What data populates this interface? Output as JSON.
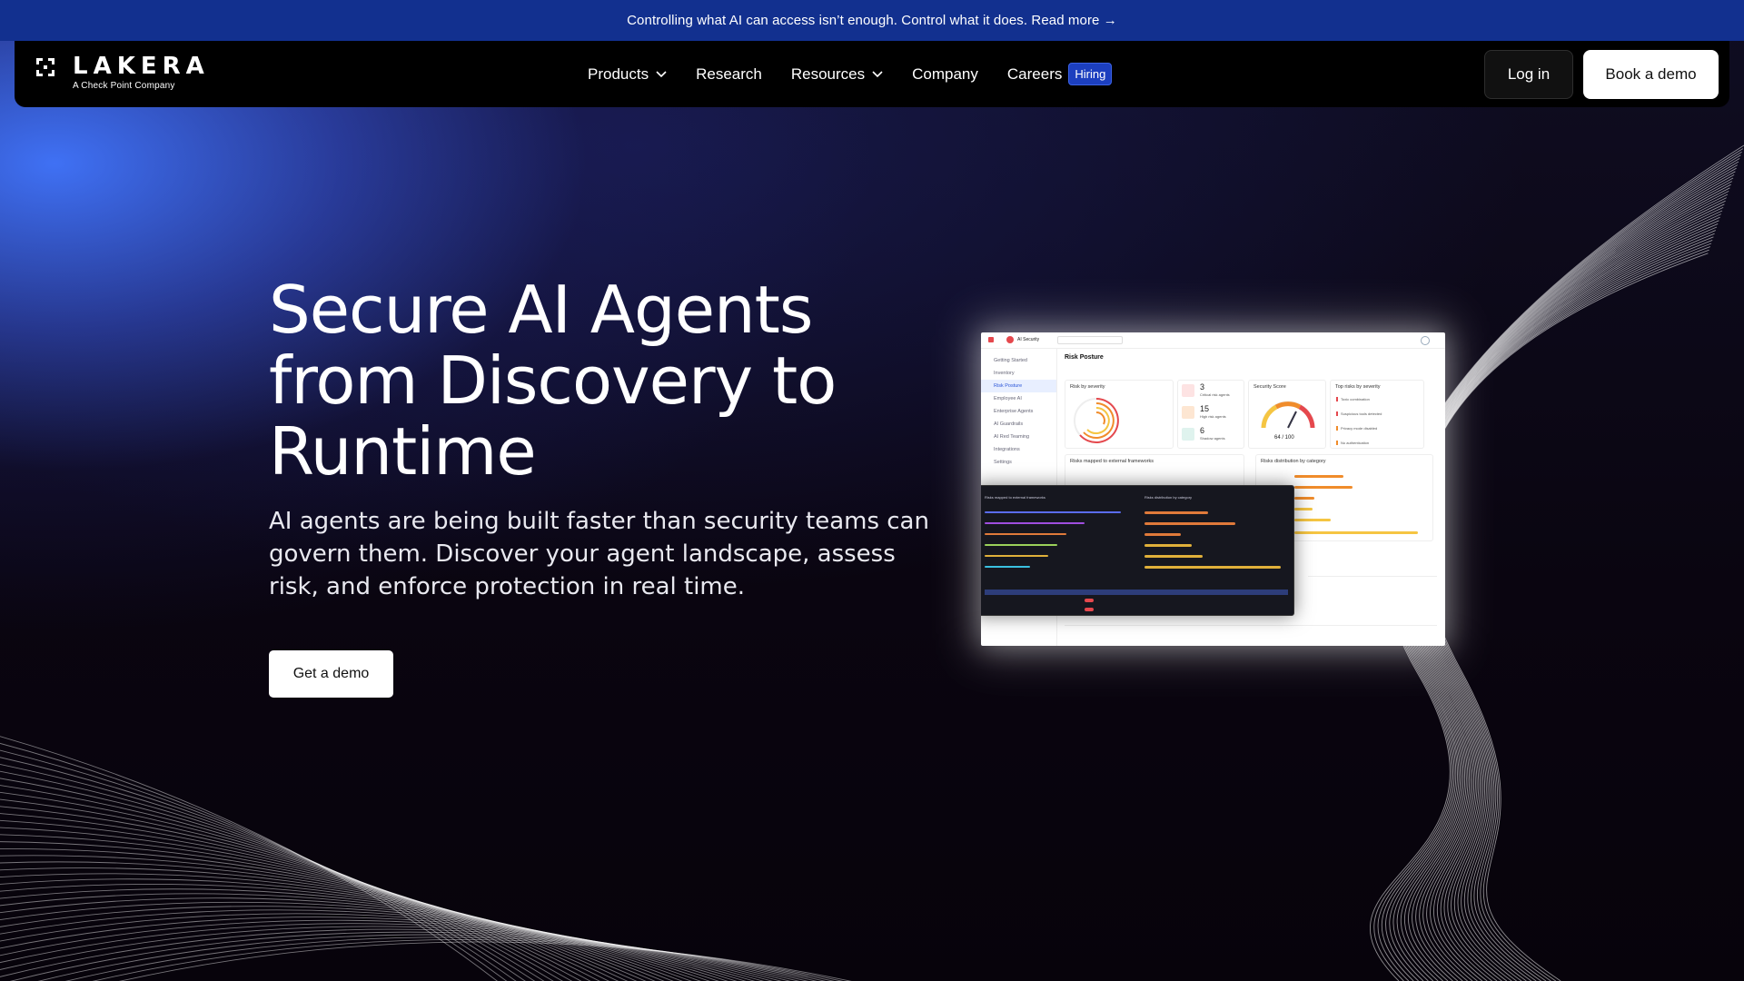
{
  "announcement": {
    "text": "Controlling what AI can access isn’t enough. Control what it does. Read more →"
  },
  "brand": {
    "name": "LAKERA",
    "tagline": "A Check Point Company"
  },
  "nav": {
    "items": [
      {
        "label": "Products",
        "has_dropdown": true
      },
      {
        "label": "Research",
        "has_dropdown": false
      },
      {
        "label": "Resources",
        "has_dropdown": true
      },
      {
        "label": "Company",
        "has_dropdown": false
      },
      {
        "label": "Careers",
        "has_dropdown": false,
        "badge": "Hiring"
      }
    ],
    "login_label": "Log in",
    "demo_label": "Book a demo"
  },
  "hero": {
    "title": "Secure AI Agents from Discovery  to Runtime",
    "subtitle": "AI agents are being built faster than security teams can govern them. Discover your agent landscape, assess risk, and enforce protection in real time.",
    "cta_label": "Get a demo"
  },
  "screenshot": {
    "app_title": "AI Security",
    "page_title": "Risk Posture",
    "sidebar": [
      "Getting Started",
      "Inventory",
      "Risk Posture",
      "Employee AI",
      "Enterprise Agents",
      "AI Guardrails",
      "AI Red Teaming",
      "Integrations",
      "Settings"
    ],
    "cards": {
      "risk_by_severity": "Risk by severity",
      "critical_count": "3",
      "critical_label": "Critical risk agents",
      "high_count": "15",
      "high_label": "High risk agents",
      "shadow_count": "6",
      "shadow_label": "Shadow agents",
      "security_score_title": "Security Score",
      "security_score": "64 / 100",
      "top_risks_title": "Top risks by severity",
      "top_risks": [
        "Toxic combination",
        "Suspicious tools detected",
        "Privacy mode disabled",
        "No authentication"
      ],
      "frameworks_title": "Risks mapped to external frameworks",
      "categories_title": "Risks distribution by category"
    }
  },
  "colors": {
    "announcement_bg": "#12308f",
    "accent_blue": "#1c3fbf",
    "critical": "#e5484d",
    "high": "#f08c2b",
    "medium": "#f5c542"
  }
}
